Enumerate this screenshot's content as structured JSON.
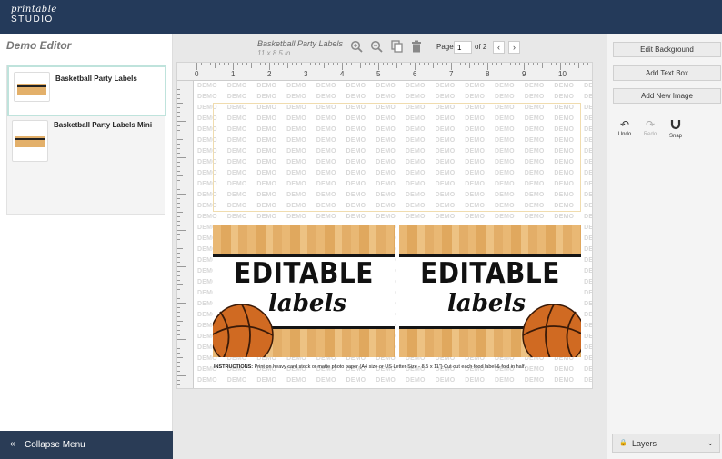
{
  "brand": {
    "script": "printable",
    "name": "STUDIO"
  },
  "sidebar": {
    "title": "Demo Editor",
    "templates": [
      {
        "name": "Basketball Party Labels",
        "active": true
      },
      {
        "name": "Basketball Party Labels Mini",
        "active": false
      }
    ],
    "collapse_label": "Collapse Menu",
    "collapse_icon": "double-chevron-left-icon"
  },
  "canvas": {
    "title": "Basketball Party Labels",
    "size": "11 x 8.5 in",
    "tools": [
      "zoom-in-icon",
      "zoom-out-icon",
      "copy-icon",
      "trash-icon"
    ],
    "page_label": "Page",
    "page_current": "1",
    "page_of": "of 2",
    "ruler_numbers": [
      "0",
      "1",
      "2",
      "3",
      "4",
      "5",
      "6",
      "7",
      "8",
      "9",
      "10"
    ],
    "watermark": "DEMO",
    "label_title": "EDITABLE",
    "label_subtitle": "labels",
    "instructions_bold": "INSTRUCTIONS:",
    "instructions_text": " Print on heavy card stock or matte photo paper (A4 size or US Letter Size - 8.5 x 11\") Cut out each food label & fold in half."
  },
  "right_panel": {
    "buttons": [
      "Edit Background",
      "Add Text Box",
      "Add New Image"
    ],
    "actions": [
      {
        "label": "Undo",
        "icon": "undo-icon",
        "enabled": true
      },
      {
        "label": "Redo",
        "icon": "redo-icon",
        "enabled": false
      },
      {
        "label": "Snap",
        "icon": "magnet-icon",
        "enabled": true
      }
    ],
    "layers_label": "Layers"
  },
  "colors": {
    "topbar": "#243a5a",
    "collapse_bar": "#2a3c56",
    "active_outline": "#bfe3dc",
    "wood": "#e3ae68"
  }
}
